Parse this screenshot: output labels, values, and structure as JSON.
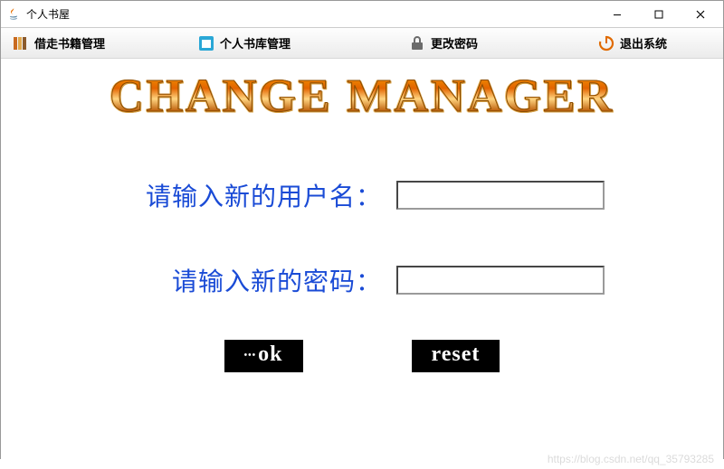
{
  "window": {
    "title": "个人书屋"
  },
  "menu": {
    "items": [
      {
        "label": "借走书籍管理"
      },
      {
        "label": "个人书库管理"
      },
      {
        "label": "更改密码"
      },
      {
        "label": "退出系统"
      }
    ]
  },
  "heading": "CHANGE MANAGER",
  "form": {
    "username_label": "请输入新的用户名：",
    "username_value": "",
    "password_label": "请输入新的密码：",
    "password_value": ""
  },
  "buttons": {
    "ok_label": "ok",
    "reset_label": "reset"
  },
  "watermark": "https://blog.csdn.net/qq_35793285"
}
